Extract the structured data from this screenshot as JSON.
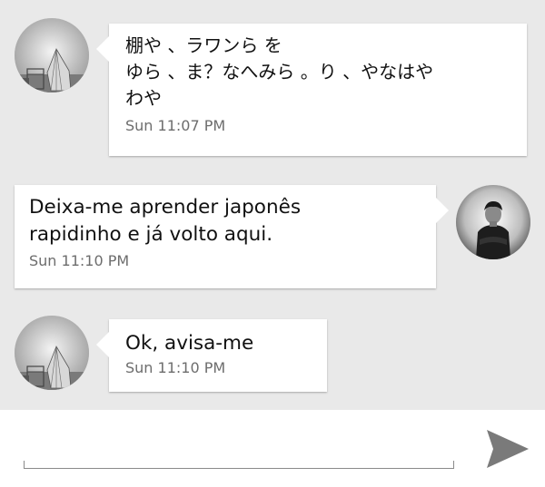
{
  "messages": [
    {
      "side": "left",
      "sender": "other",
      "avatar": "tent-avatar",
      "text": "棚や 、ラワンら を\nゆら 、ま？なへみら 。り 、やなはや\nわや",
      "time": "Sun 11:07 PM"
    },
    {
      "side": "right",
      "sender": "me",
      "avatar": "person-avatar",
      "text": "Deixa-me aprender japonês\nrapidinho e já volto aqui.",
      "time": "Sun 11:10 PM"
    },
    {
      "side": "left",
      "sender": "other",
      "avatar": "tent-avatar",
      "text": "Ok, avisa-me",
      "time": "Sun 11:10 PM"
    }
  ],
  "composer": {
    "value": "",
    "send_icon": "send-icon"
  },
  "colors": {
    "background": "#e9e9e9",
    "bubble": "#ffffff",
    "text": "#111111",
    "timestamp": "#6d6d6d",
    "send_icon": "#7a7a7a"
  }
}
